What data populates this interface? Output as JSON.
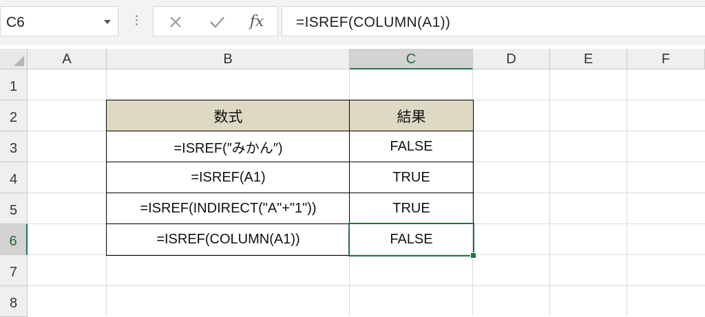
{
  "formula_bar": {
    "name_box": "C6",
    "cancel_icon": "cross-icon",
    "enter_icon": "check-icon",
    "insert_function_label": "fx",
    "formula": "=ISREF(COLUMN(A1))"
  },
  "columns": [
    "A",
    "B",
    "C",
    "D",
    "E",
    "F"
  ],
  "rows": [
    "1",
    "2",
    "3",
    "4",
    "5",
    "6",
    "7",
    "8"
  ],
  "selected": {
    "column": "C",
    "row": "6"
  },
  "table": {
    "headers": [
      "数式",
      "結果"
    ],
    "header_fill": "#DDD9C3",
    "rows": [
      {
        "formula": "=ISREF(″みかん″)",
        "result": "FALSE"
      },
      {
        "formula": "=ISREF(A1)",
        "result": "TRUE"
      },
      {
        "formula": "=ISREF(INDIRECT(\"A\"+\"1\"))",
        "result": "TRUE"
      },
      {
        "formula": "=ISREF(COLUMN(A1))",
        "result": "FALSE"
      }
    ]
  },
  "colors": {
    "accent": "#217346",
    "grid": "#DADADA"
  }
}
